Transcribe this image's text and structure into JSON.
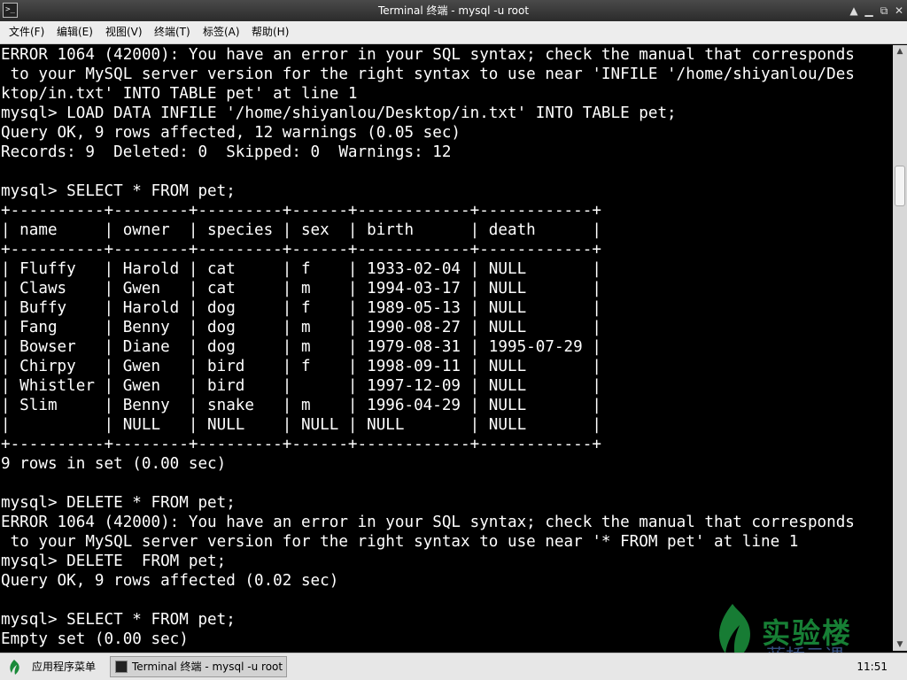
{
  "window": {
    "title": "Terminal 终端 - mysql -u root",
    "icon": "terminal-icon",
    "controls": [
      "shade-icon",
      "minimize-icon",
      "maximize-icon",
      "close-icon"
    ]
  },
  "menu": [
    {
      "label": "文件(F)"
    },
    {
      "label": "编辑(E)"
    },
    {
      "label": "视图(V)"
    },
    {
      "label": "终端(T)"
    },
    {
      "label": "标签(A)"
    },
    {
      "label": "帮助(H)"
    }
  ],
  "terminal": {
    "lines": [
      "ERROR 1064 (42000): You have an error in your SQL syntax; check the manual that corresponds",
      " to your MySQL server version for the right syntax to use near 'INFILE '/home/shiyanlou/Des",
      "ktop/in.txt' INTO TABLE pet' at line 1",
      "mysql> LOAD DATA INFILE '/home/shiyanlou/Desktop/in.txt' INTO TABLE pet;",
      "Query OK, 9 rows affected, 12 warnings (0.05 sec)",
      "Records: 9  Deleted: 0  Skipped: 0  Warnings: 12",
      "",
      "mysql> SELECT * FROM pet;",
      "+----------+--------+---------+------+------------+------------+",
      "| name     | owner  | species | sex  | birth      | death      |",
      "+----------+--------+---------+------+------------+------------+",
      "| Fluffy   | Harold | cat     | f    | 1933-02-04 | NULL       |",
      "| Claws    | Gwen   | cat     | m    | 1994-03-17 | NULL       |",
      "| Buffy    | Harold | dog     | f    | 1989-05-13 | NULL       |",
      "| Fang     | Benny  | dog     | m    | 1990-08-27 | NULL       |",
      "| Bowser   | Diane  | dog     | m    | 1979-08-31 | 1995-07-29 |",
      "| Chirpy   | Gwen   | bird    | f    | 1998-09-11 | NULL       |",
      "| Whistler | Gwen   | bird    |      | 1997-12-09 | NULL       |",
      "| Slim     | Benny  | snake   | m    | 1996-04-29 | NULL       |",
      "|          | NULL   | NULL    | NULL | NULL       | NULL       |",
      "+----------+--------+---------+------+------------+------------+",
      "9 rows in set (0.00 sec)",
      "",
      "mysql> DELETE * FROM pet;",
      "ERROR 1064 (42000): You have an error in your SQL syntax; check the manual that corresponds",
      " to your MySQL server version for the right syntax to use near '* FROM pet' at line 1",
      "mysql> DELETE  FROM pet;",
      "Query OK, 9 rows affected (0.02 sec)",
      "",
      "mysql> SELECT * FROM pet;",
      "Empty set (0.00 sec)"
    ]
  },
  "scrollbar": {
    "position": 0.2
  },
  "watermark": {
    "text": "实验楼",
    "sub": "蓝桥云课",
    "icon": "shiyanlou-leaf-logo"
  },
  "taskbar": {
    "start_label": "应用程序菜单",
    "task_label": "Terminal 终端 - mysql -u root",
    "clock": "11:51"
  },
  "colors": {
    "terminal_bg": "#000000",
    "terminal_fg": "#ffffff",
    "watermark_green": "#1a8a3a"
  }
}
